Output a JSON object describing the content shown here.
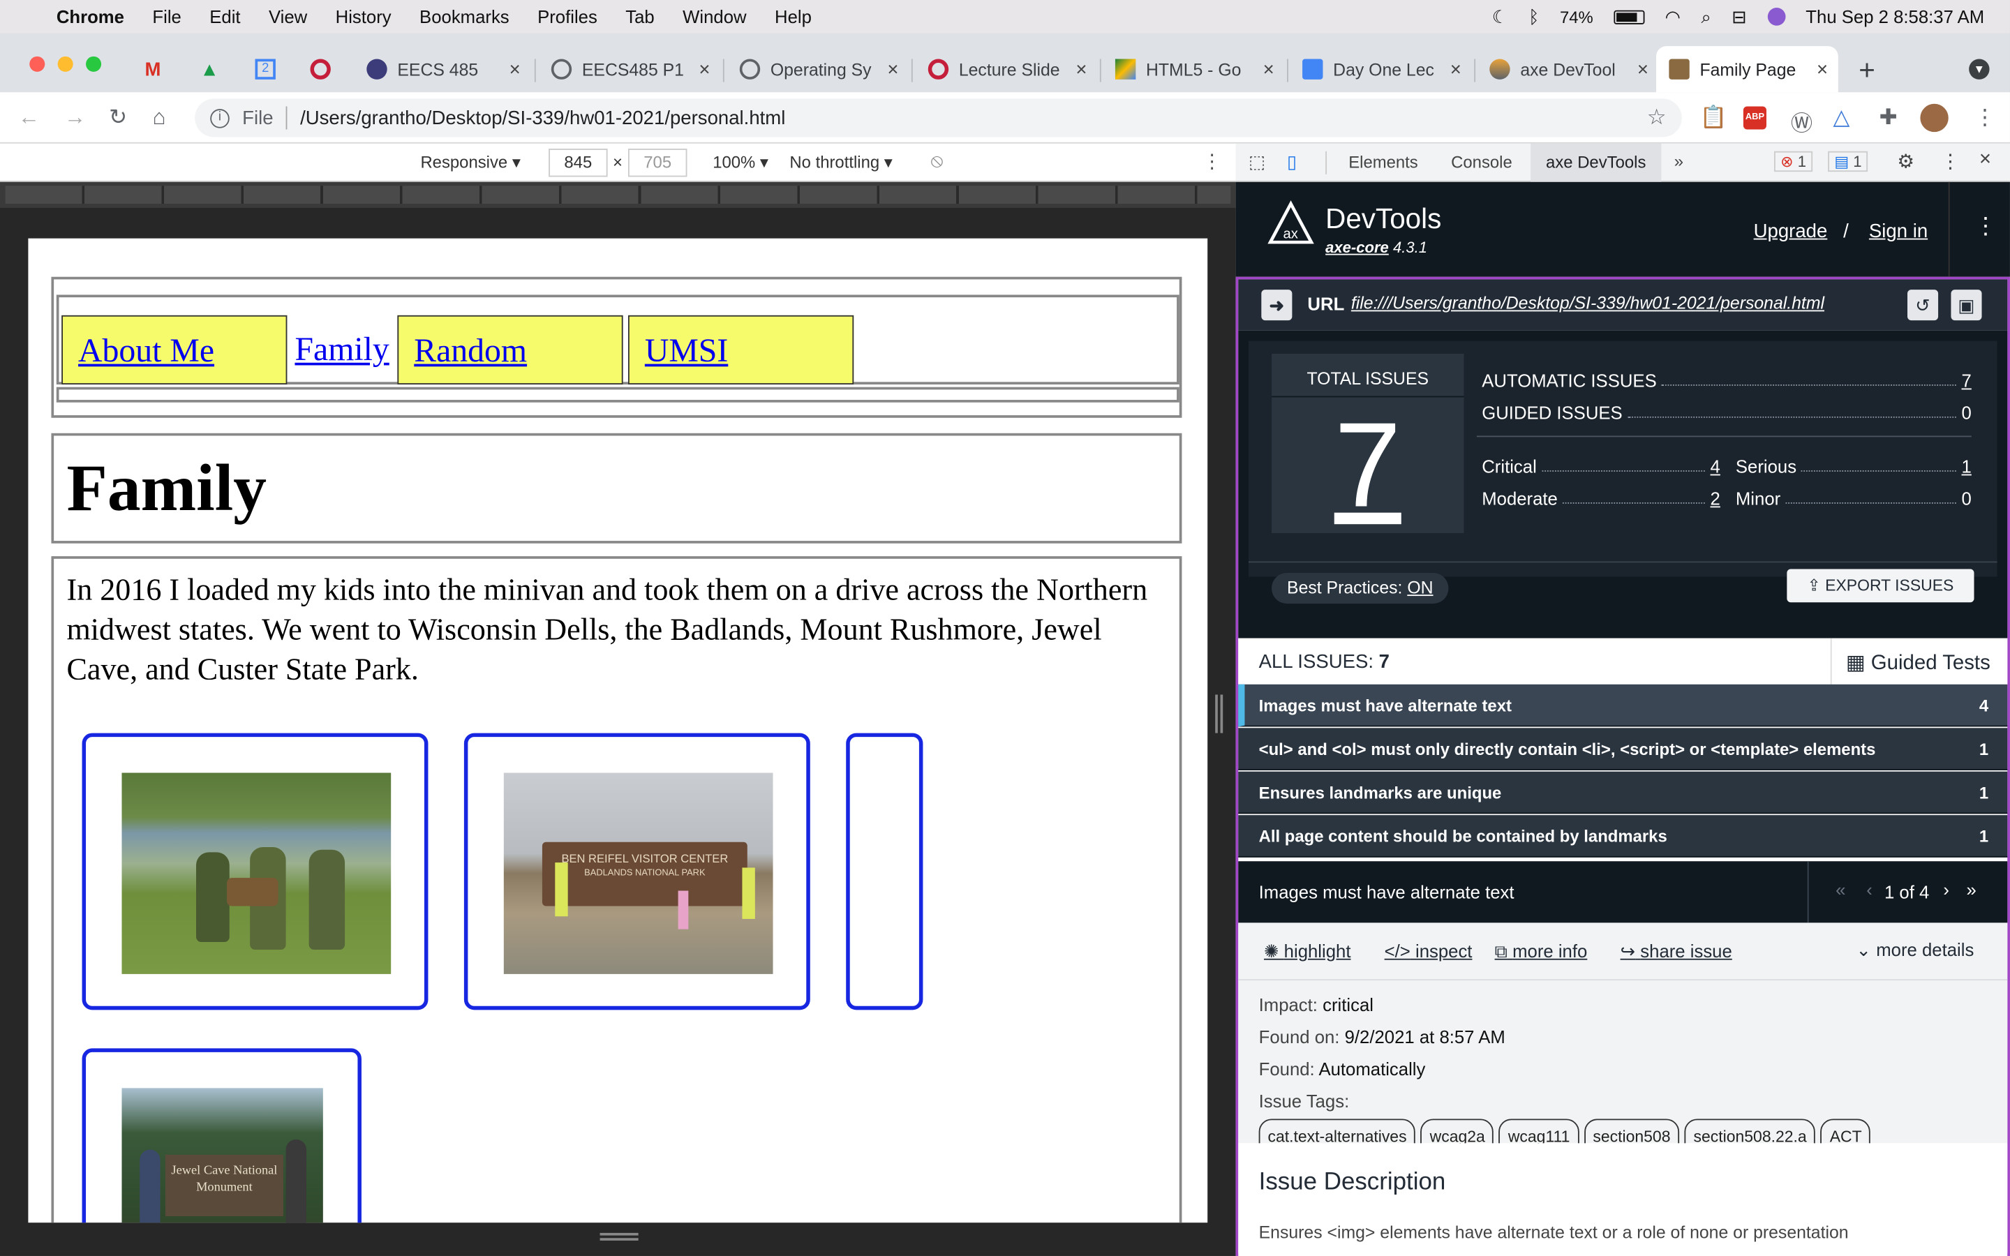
{
  "menubar": {
    "app": "Chrome",
    "items": [
      "File",
      "Edit",
      "View",
      "History",
      "Bookmarks",
      "Profiles",
      "Tab",
      "Window",
      "Help"
    ],
    "battery": "74%",
    "clock": "Thu Sep 2  8:58:37 AM"
  },
  "tabs": [
    {
      "label": "EECS 485",
      "color": "#3c3c7a"
    },
    {
      "label": "EECS485 P1",
      "color": "#5f6368"
    },
    {
      "label": "Operating Sy",
      "color": "#5f6368"
    },
    {
      "label": "Lecture Slide",
      "color": "#c41e3a"
    },
    {
      "label": "HTML5 - Go",
      "color": "#188038"
    },
    {
      "label": "Day One Lec",
      "color": "#4285f4"
    },
    {
      "label": "axe DevTool",
      "color": "#e8a33a"
    },
    {
      "label": "Family Page",
      "color": "#8a6a40"
    }
  ],
  "toolbar": {
    "url_scheme": "File",
    "url_path": "/Users/grantho/Desktop/SI-339/hw01-2021/personal.html"
  },
  "device_toolbar": {
    "mode": "Responsive ▾",
    "width": "845",
    "height": "705",
    "zoom": "100% ▾",
    "throttle": "No throttling ▾"
  },
  "page": {
    "nav": [
      "About Me",
      "Family",
      "Random",
      "UMSI"
    ],
    "heading": "Family",
    "paragraph": "In 2016 I loaded my kids into the minivan and took them on a drive across the Northern midwest states. We went to Wisconsin Dells, the Badlands, Mount Rushmore, Jewel Cave, and Custer State Park.",
    "photo2_sign": "BEN REIFEL VISITOR CENTER",
    "photo2_sub": "BADLANDS NATIONAL PARK",
    "photo3_sign": "Jewel Cave National Monument"
  },
  "devtools": {
    "tabs": [
      "Elements",
      "Console",
      "axe DevTools"
    ],
    "errors": "1",
    "messages": "1"
  },
  "axe": {
    "product": "DevTools",
    "core": "axe-core",
    "version": "4.3.1",
    "upgrade": "Upgrade",
    "slash": "/",
    "signin": "Sign in",
    "url_label": "URL",
    "url": "file:///Users/grantho/Desktop/SI-339/hw01-2021/personal.html",
    "total_label": "TOTAL ISSUES",
    "total": "7",
    "automatic_label": "AUTOMATIC ISSUES",
    "automatic": "7",
    "guided_label": "GUIDED ISSUES",
    "guided": "0",
    "critical_label": "Critical",
    "critical": "4",
    "serious_label": "Serious",
    "serious": "1",
    "moderate_label": "Moderate",
    "moderate": "2",
    "minor_label": "Minor",
    "minor": "0",
    "best_practices": "Best Practices:",
    "best_practices_state": "ON",
    "export": "EXPORT ISSUES",
    "all_issues_label": "ALL ISSUES:",
    "all_issues": "7",
    "guided_tests": "Guided Tests",
    "issues": [
      {
        "text": "Images must have alternate text",
        "count": "4"
      },
      {
        "text": "<ul> and <ol> must only directly contain <li>, <script> or <template> elements",
        "count": "1"
      },
      {
        "text": "Ensures landmarks are unique",
        "count": "1"
      },
      {
        "text": "All page content should be contained by landmarks",
        "count": "1"
      }
    ],
    "detail_title": "Images must have alternate text",
    "pager": "1 of 4",
    "actions": [
      "highlight",
      "inspect",
      "more info",
      "share issue"
    ],
    "more_details": "more details",
    "impact_label": "Impact:",
    "impact": "critical",
    "found_on_label": "Found on:",
    "found_on": "9/2/2021 at 8:57 AM",
    "found_label": "Found:",
    "found": "Automatically",
    "tags_label": "Issue Tags:",
    "tags": [
      "cat.text-alternatives",
      "wcag2a",
      "wcag111",
      "section508",
      "section508.22.a",
      "ACT"
    ],
    "desc_title": "Issue Description",
    "desc": "Ensures <img> elements have alternate text or a role of none or presentation"
  }
}
